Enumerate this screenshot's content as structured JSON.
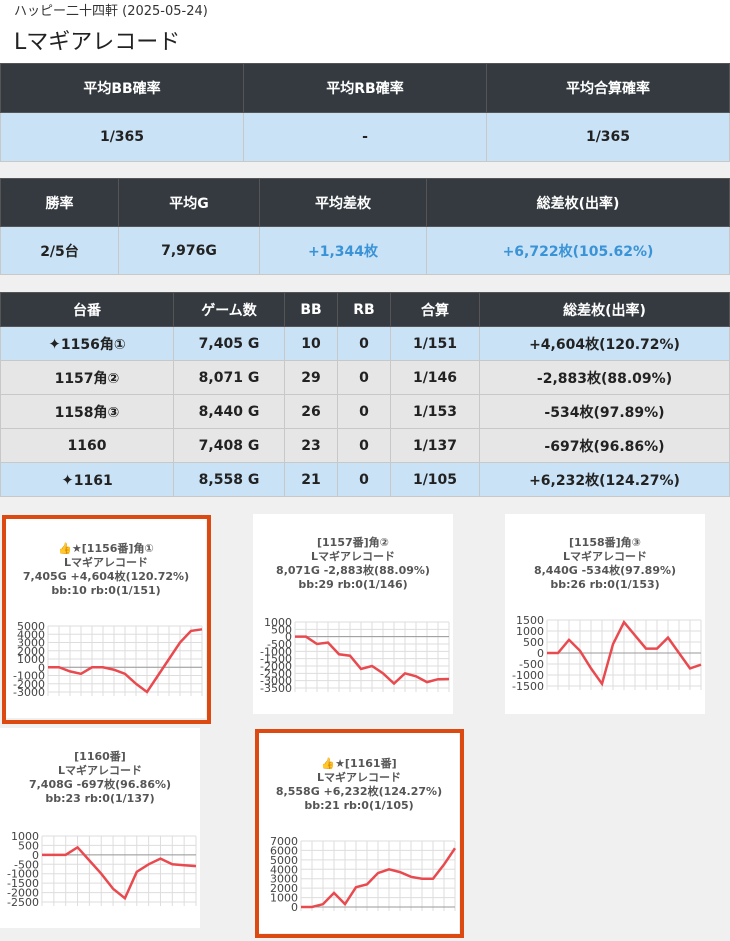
{
  "header": {
    "subtitle": "ハッピー二十四軒 (2025-05-24)",
    "title": "Lマギアレコード"
  },
  "stats1": {
    "headers": [
      "平均BB確率",
      "平均RB確率",
      "平均合算確率"
    ],
    "values": [
      "1/365",
      "-",
      "1/365"
    ]
  },
  "stats2": {
    "headers": [
      "勝率",
      "平均G",
      "平均差枚",
      "総差枚(出率)"
    ],
    "values": [
      "2/5台",
      "7,976G",
      "+1,344枚",
      "+6,722枚(105.62%)"
    ]
  },
  "machines": {
    "headers": [
      "台番",
      "ゲーム数",
      "BB",
      "RB",
      "合算",
      "総差枚(出率)"
    ],
    "rows": [
      {
        "icon": "✦",
        "no": "1156角①",
        "games": "7,405 G",
        "bb": "10",
        "rb": "0",
        "total": "1/151",
        "diff": "+4,604枚(120.72%)"
      },
      {
        "icon": "",
        "no": "1157角②",
        "games": "8,071 G",
        "bb": "29",
        "rb": "0",
        "total": "1/146",
        "diff": "-2,883枚(88.09%)"
      },
      {
        "icon": "",
        "no": "1158角③",
        "games": "8,440 G",
        "bb": "26",
        "rb": "0",
        "total": "1/153",
        "diff": "-534枚(97.89%)"
      },
      {
        "icon": "",
        "no": "1160",
        "games": "7,408 G",
        "bb": "23",
        "rb": "0",
        "total": "1/137",
        "diff": "-697枚(96.86%)"
      },
      {
        "icon": "✦",
        "no": "1161",
        "games": "8,558 G",
        "bb": "21",
        "rb": "0",
        "total": "1/105",
        "diff": "+6,232枚(124.27%)"
      }
    ]
  },
  "cards": [
    {
      "line1": "👍★[1156番]角①",
      "line2": "Lマギアレコード",
      "line3": "7,405G +4,604枚(120.72%)",
      "line4": "bb:10 rb:0(1/151)"
    },
    {
      "line1": "[1157番]角②",
      "line2": "Lマギアレコード",
      "line3": "8,071G -2,883枚(88.09%)",
      "line4": "bb:29 rb:0(1/146)"
    },
    {
      "line1": "[1158番]角③",
      "line2": "Lマギアレコード",
      "line3": "8,440G -534枚(97.89%)",
      "line4": "bb:26 rb:0(1/153)"
    },
    {
      "line1": "[1160番]",
      "line2": "Lマギアレコード",
      "line3": "7,408G -697枚(96.86%)",
      "line4": "bb:23 rb:0(1/137)"
    },
    {
      "line1": "👍★[1161番]",
      "line2": "Lマギアレコード",
      "line3": "8,558G +6,232枚(124.27%)",
      "line4": "bb:21 rb:0(1/105)"
    }
  ],
  "chart_data": [
    {
      "type": "line",
      "ylim": [
        -3000,
        5000
      ],
      "yticks": [
        "5000",
        "4000",
        "3000",
        "2000",
        "1000",
        "0",
        "-1000",
        "-2000",
        "-3000"
      ],
      "values": [
        0,
        0,
        -500,
        -800,
        0,
        0,
        -300,
        -800,
        -2000,
        -3000,
        -1000,
        1000,
        3000,
        4400,
        4600
      ],
      "color": "#e84a4f"
    },
    {
      "type": "line",
      "ylim": [
        -3500,
        1000
      ],
      "yticks": [
        "1000",
        "500",
        "0",
        "-500",
        "-1000",
        "-1500",
        "-2000",
        "-2500",
        "-3000",
        "-3500"
      ],
      "values": [
        0,
        0,
        -500,
        -400,
        -1200,
        -1300,
        -2200,
        -2000,
        -2500,
        -3200,
        -2500,
        -2700,
        -3100,
        -2900,
        -2883
      ],
      "color": "#e84a4f"
    },
    {
      "type": "line",
      "ylim": [
        -1500,
        1500
      ],
      "yticks": [
        "1500",
        "1000",
        "500",
        "0",
        "-500",
        "-1000",
        "-1500"
      ],
      "values": [
        0,
        0,
        600,
        100,
        -700,
        -1400,
        400,
        1400,
        800,
        200,
        200,
        700,
        0,
        -700,
        -534
      ],
      "color": "#e84a4f"
    },
    {
      "type": "line",
      "ylim": [
        -2500,
        1000
      ],
      "yticks": [
        "1000",
        "500",
        "0",
        "-500",
        "-1000",
        "-1500",
        "-2000",
        "-2500"
      ],
      "values": [
        0,
        0,
        0,
        400,
        -300,
        -1000,
        -1800,
        -2300,
        -900,
        -500,
        -200,
        -500,
        -550,
        -600
      ],
      "color": "#e84a4f"
    },
    {
      "type": "line",
      "ylim": [
        0,
        7000
      ],
      "yticks": [
        "7000",
        "6000",
        "5000",
        "4000",
        "3000",
        "2000",
        "1000",
        "0"
      ],
      "values": [
        0,
        0,
        300,
        1500,
        300,
        2100,
        2400,
        3600,
        4000,
        3700,
        3200,
        3000,
        3000,
        4500,
        6232
      ],
      "color": "#e84a4f"
    }
  ]
}
